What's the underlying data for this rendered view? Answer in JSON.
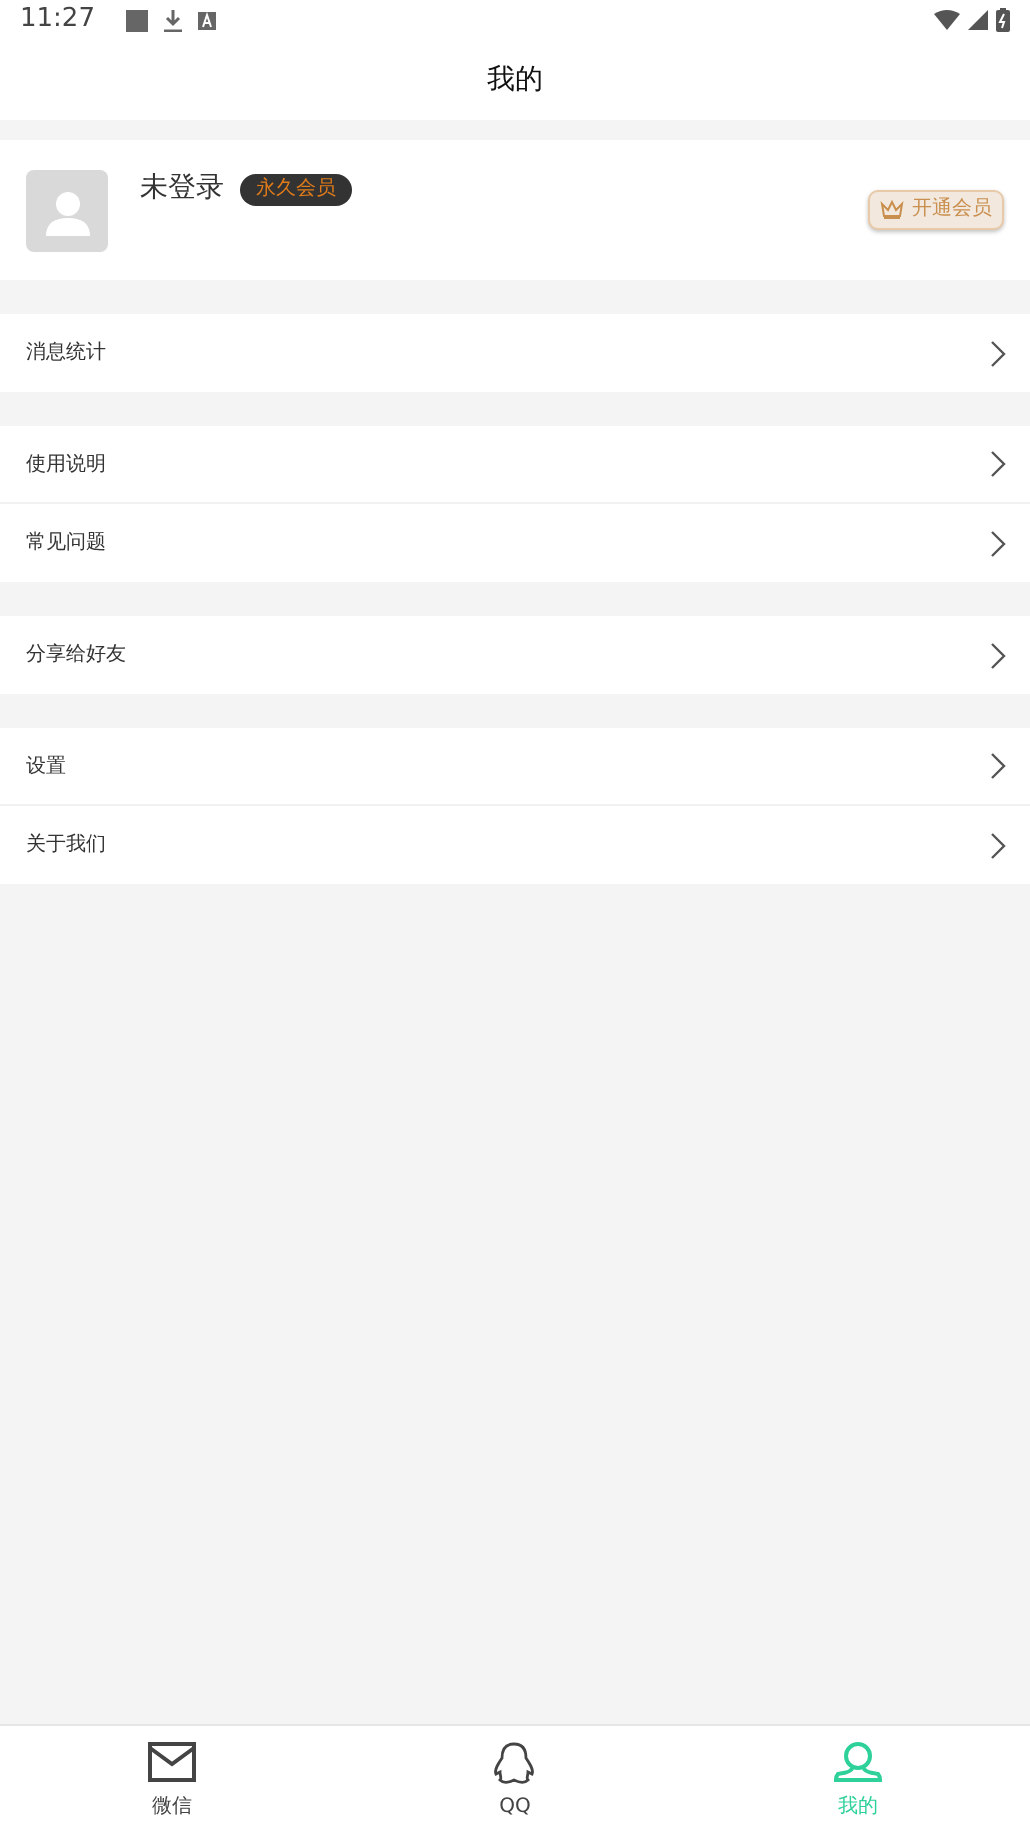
{
  "status_bar": {
    "time": "11:27"
  },
  "header": {
    "title": "我的"
  },
  "profile": {
    "name": "未登录",
    "badge": "永久会员",
    "vip_button": "开通会员"
  },
  "menu_groups": [
    {
      "items": [
        {
          "label": "消息统计"
        }
      ]
    },
    {
      "items": [
        {
          "label": "使用说明"
        },
        {
          "label": "常见问题"
        }
      ]
    },
    {
      "items": [
        {
          "label": "分享给好友"
        }
      ]
    },
    {
      "items": [
        {
          "label": "设置"
        },
        {
          "label": "关于我们"
        }
      ]
    }
  ],
  "tabs": [
    {
      "label": "微信",
      "kind": "mail",
      "selected": false
    },
    {
      "label": "QQ",
      "kind": "qq",
      "selected": false
    },
    {
      "label": "我的",
      "kind": "person",
      "selected": true
    }
  ]
}
